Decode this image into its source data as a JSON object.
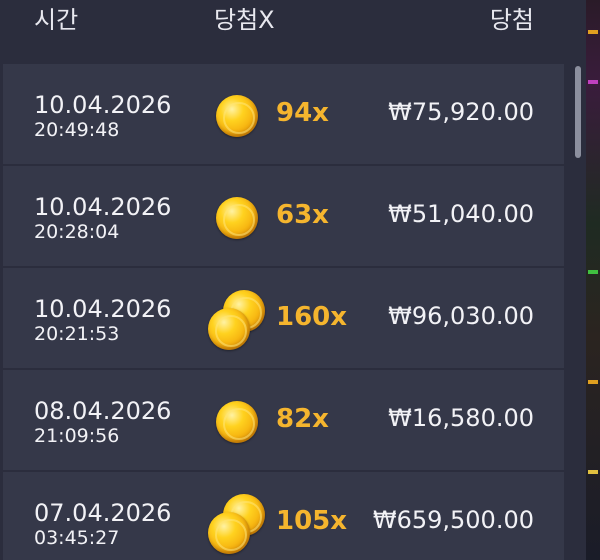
{
  "header": {
    "time_label": "시간",
    "multiplier_label": "당첨X",
    "win_label": "당첨"
  },
  "rows": [
    {
      "date": "10.04.2026",
      "time": "20:49:48",
      "multiplier": "94x",
      "amount": "₩75,920.00",
      "coins": "single"
    },
    {
      "date": "10.04.2026",
      "time": "20:28:04",
      "multiplier": "63x",
      "amount": "₩51,040.00",
      "coins": "single"
    },
    {
      "date": "10.04.2026",
      "time": "20:21:53",
      "multiplier": "160x",
      "amount": "₩96,030.00",
      "coins": "double"
    },
    {
      "date": "08.04.2026",
      "time": "21:09:56",
      "multiplier": "82x",
      "amount": "₩16,580.00",
      "coins": "single"
    },
    {
      "date": "07.04.2026",
      "time": "03:45:27",
      "multiplier": "105x",
      "amount": "₩659,500.00",
      "coins": "double"
    }
  ],
  "colors": {
    "background": "#2b2d3d",
    "row_background": "#353849",
    "multiplier": "#f5b52e",
    "text": "#f2f2f6"
  }
}
